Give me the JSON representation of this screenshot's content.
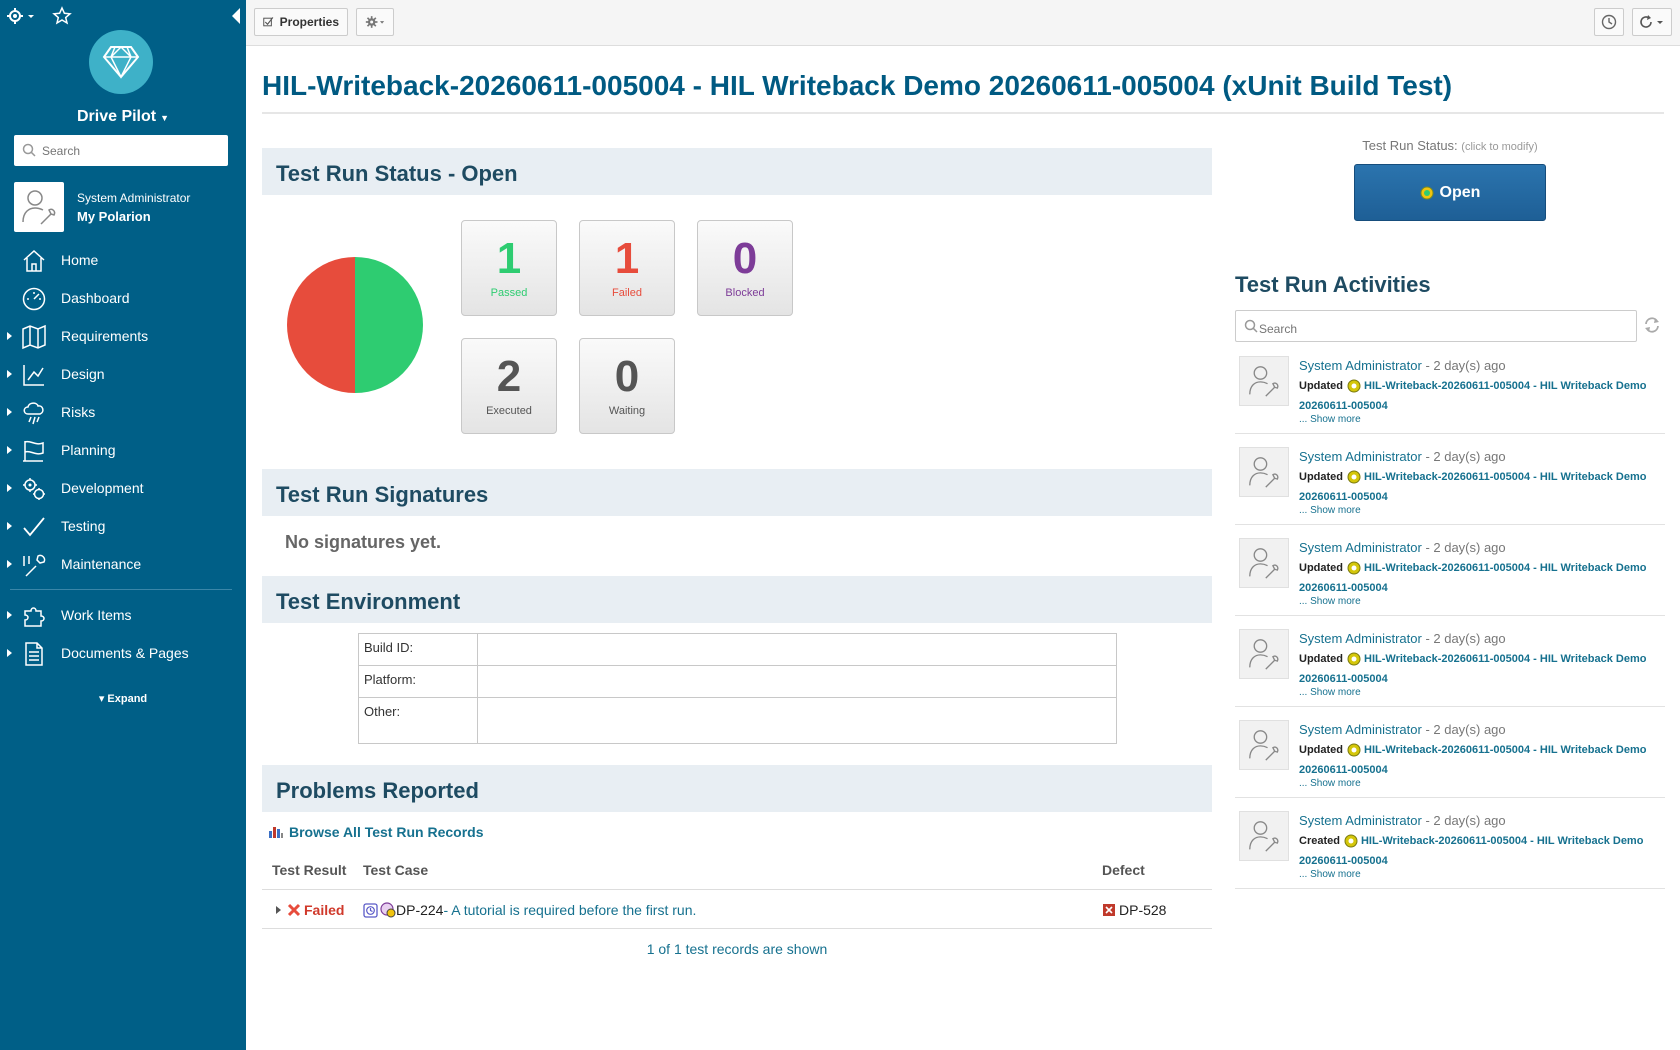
{
  "sidebar": {
    "project_name": "Drive Pilot",
    "search_placeholder": "Search",
    "user_role": "System Administrator",
    "user_link": "My Polarion",
    "items": [
      {
        "label": "Home",
        "icon": "home-icon",
        "expandable": false
      },
      {
        "label": "Dashboard",
        "icon": "dashboard-icon",
        "expandable": false
      },
      {
        "label": "Requirements",
        "icon": "map-icon",
        "expandable": true
      },
      {
        "label": "Design",
        "icon": "design-icon",
        "expandable": true
      },
      {
        "label": "Risks",
        "icon": "risk-icon",
        "expandable": true
      },
      {
        "label": "Planning",
        "icon": "planning-icon",
        "expandable": true
      },
      {
        "label": "Development",
        "icon": "gears-icon",
        "expandable": true
      },
      {
        "label": "Testing",
        "icon": "check-icon",
        "expandable": true
      },
      {
        "label": "Maintenance",
        "icon": "wrench-icon",
        "expandable": true
      }
    ],
    "items2": [
      {
        "label": "Work Items",
        "icon": "puzzle-icon",
        "expandable": true
      },
      {
        "label": "Documents & Pages",
        "icon": "document-icon",
        "expandable": true
      }
    ],
    "expand_label": "Expand"
  },
  "toolbar": {
    "properties_label": "Properties"
  },
  "page": {
    "title": "HIL-Writeback-20260611-005004 - HIL Writeback Demo 20260611-005004 (xUnit Build Test)"
  },
  "status_section": {
    "heading": "Test Run Status - Open",
    "stats": {
      "passed": {
        "value": "1",
        "label": "Passed",
        "color": "#2ecc71"
      },
      "failed": {
        "value": "1",
        "label": "Failed",
        "color": "#e74c3c"
      },
      "blocked": {
        "value": "0",
        "label": "Blocked",
        "color": "#7d3c98"
      },
      "executed": {
        "value": "2",
        "label": "Executed",
        "color": "#555555"
      },
      "waiting": {
        "value": "0",
        "label": "Waiting",
        "color": "#555555"
      }
    },
    "pie": {
      "passed": 1,
      "failed": 1
    }
  },
  "signatures": {
    "heading": "Test Run Signatures",
    "empty_text": "No signatures yet."
  },
  "environment": {
    "heading": "Test Environment",
    "rows": [
      {
        "key": "Build ID:",
        "value": ""
      },
      {
        "key": "Platform:",
        "value": ""
      },
      {
        "key": "Other:",
        "value": ""
      }
    ]
  },
  "problems": {
    "heading": "Problems Reported",
    "browse_link": "Browse All Test Run Records",
    "columns": {
      "result": "Test Result",
      "case": "Test Case",
      "defect": "Defect"
    },
    "row": {
      "result": "Failed",
      "case_id": "DP-224",
      "case_title": " - A tutorial is required before the first run.",
      "defect": "DP-528"
    },
    "count_text": "1 of 1 test records are shown"
  },
  "right_panel": {
    "status_label": "Test Run Status:",
    "status_hint": "(click to modify)",
    "status_button": "Open",
    "activities_title": "Test Run Activities",
    "activities_search_placeholder": "Search",
    "activities": [
      {
        "who": "System Administrator",
        "ago": " - 2 day(s) ago",
        "verb": "Updated",
        "link": "HIL-Writeback-20260611-005004 - HIL Writeback Demo 20260611-005004",
        "more": "... Show more"
      },
      {
        "who": "System Administrator",
        "ago": " - 2 day(s) ago",
        "verb": "Updated",
        "link": "HIL-Writeback-20260611-005004 - HIL Writeback Demo 20260611-005004",
        "more": "... Show more"
      },
      {
        "who": "System Administrator",
        "ago": " - 2 day(s) ago",
        "verb": "Updated",
        "link": "HIL-Writeback-20260611-005004 - HIL Writeback Demo 20260611-005004",
        "more": "... Show more"
      },
      {
        "who": "System Administrator",
        "ago": " - 2 day(s) ago",
        "verb": "Updated",
        "link": "HIL-Writeback-20260611-005004 - HIL Writeback Demo 20260611-005004",
        "more": "... Show more"
      },
      {
        "who": "System Administrator",
        "ago": " - 2 day(s) ago",
        "verb": "Updated",
        "link": "HIL-Writeback-20260611-005004 - HIL Writeback Demo 20260611-005004",
        "more": "... Show more"
      },
      {
        "who": "System Administrator",
        "ago": " - 2 day(s) ago",
        "verb": "Created",
        "link": "HIL-Writeback-20260611-005004 - HIL Writeback Demo 20260611-005004",
        "more": "... Show more"
      }
    ]
  }
}
